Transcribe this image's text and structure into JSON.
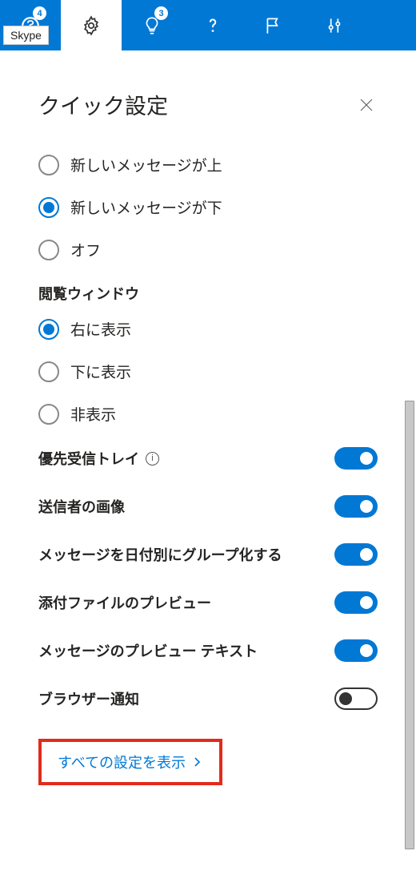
{
  "tooltip": "Skype",
  "toolbar": {
    "skype_badge": "4",
    "tips_badge": "3"
  },
  "panel": {
    "title": "クイック設定"
  },
  "radio_group1": {
    "opt1": "新しいメッセージが上",
    "opt2": "新しいメッセージが下",
    "opt3": "オフ"
  },
  "reading_pane": {
    "label": "閲覧ウィンドウ",
    "opt1": "右に表示",
    "opt2": "下に表示",
    "opt3": "非表示"
  },
  "toggles": {
    "focused": "優先受信トレイ",
    "sender_img": "送信者の画像",
    "group_date": "メッセージを日付別にグループ化する",
    "attach_preview": "添付ファイルのプレビュー",
    "msg_preview": "メッセージのプレビュー テキスト",
    "browser_notif": "ブラウザー通知"
  },
  "link": "すべての設定を表示",
  "info_glyph": "i"
}
